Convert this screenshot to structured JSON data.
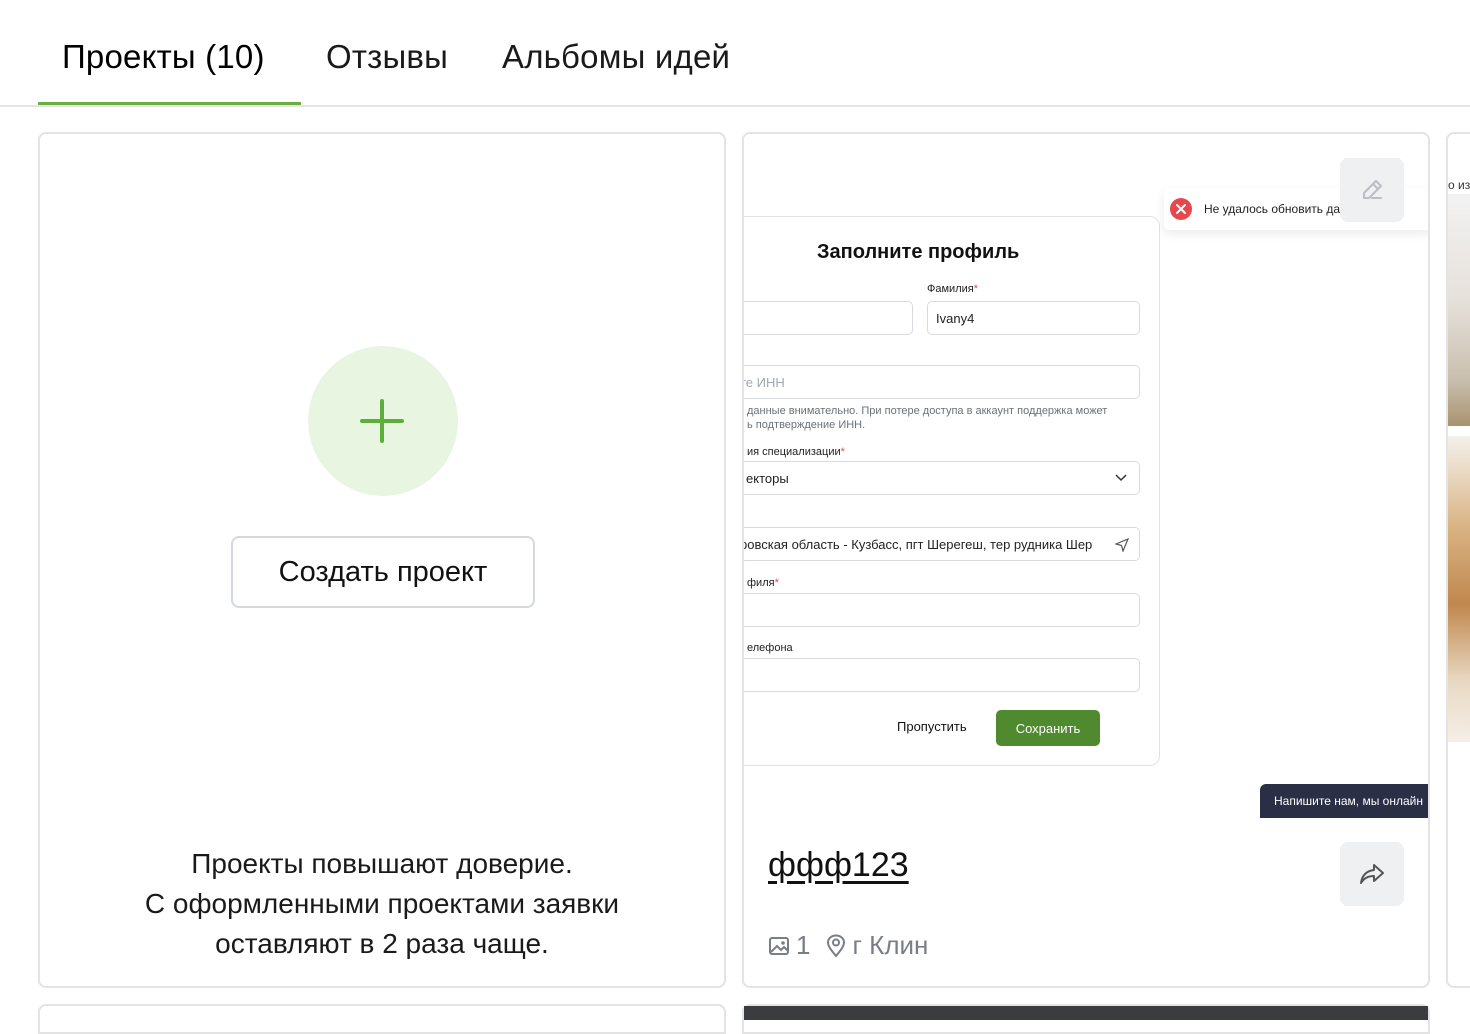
{
  "tabs": [
    {
      "label": "Проекты (10)",
      "active": true
    },
    {
      "label": "Отзывы",
      "active": false
    },
    {
      "label": "Альбомы идей",
      "active": false
    }
  ],
  "accent_color": "#6aae3f",
  "create_card": {
    "button_label": "Создать проект",
    "hint_lines": [
      "Проекты повышают доверие.",
      "С оформленными проектами заявки",
      "оставляют в 2 раза чаще."
    ]
  },
  "project_card": {
    "title": "ффф123",
    "photo_count": "1",
    "location": "г Клин",
    "preview": {
      "toast": "Не удалось обновить данные",
      "modal_title": "Заполните профиль",
      "surname_label": "Фамилия",
      "surname_value": "Ivany4",
      "inn_placeholder": "те ИНН",
      "inn_note_line1": "данные внимательно. При потере доступа в аккаунт поддержка может",
      "inn_note_line2": "ь подтверждение ИНН.",
      "spec_label": "ия специализации",
      "spec_value": "екторы",
      "address_value": "ровская область - Кузбасс, пгт Шерегеш, тер рудника Шер",
      "profile_label": "филя",
      "phone_label": "елефона",
      "skip_label": "Пропустить",
      "save_label": "Сохранить",
      "chat_text": "Напишите нам, мы онлайн"
    }
  },
  "side_card": {
    "text": "о из"
  }
}
